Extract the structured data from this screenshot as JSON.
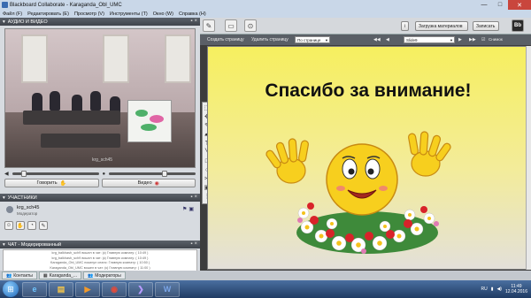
{
  "window": {
    "title": "Blackboard Collaborate - Karaganda_Obl_UMC",
    "minimize": "—",
    "maximize": "□",
    "close": "✕"
  },
  "menu": {
    "items": [
      "Файл (F)",
      "Редактировать (E)",
      "Просмотр (V)",
      "Инструменты (T)",
      "Окно (W)",
      "Справка (H)"
    ]
  },
  "audio_video": {
    "header": "АУДИО И ВИДЕО",
    "video_label": "krg_sch45",
    "talk_button": "Говорить",
    "video_button": "Видео"
  },
  "participants": {
    "header": "УЧАСТНИКИ",
    "items": [
      {
        "name": "krg_sch45",
        "role": "Модератор"
      }
    ]
  },
  "chat": {
    "header": "ЧАТ - Модерированный",
    "lines": [
      "krg_balkhash_sch9 вошел в чат: (к) Главную комнату: ( 10:49 )",
      "krg_balkhash_sch9 вошел в чат: (к) Главную комнату: ( 10:49 )",
      "Karaganda_Obl_UMC покинул сеанс: Главную комнату: ( 10:50 )",
      "Karaganda_Obl_UMC вошел в чат: (к) Главную комнату: ( 11:00 )"
    ]
  },
  "bottom_tabs": {
    "items": [
      "Контакты",
      "Karaganda_...",
      "Модераторы"
    ]
  },
  "toolbar": {
    "load_content": "Загрузка материалов",
    "record": "Записать",
    "save_page": "Создать страницу",
    "delete_page": "Удалить страницу",
    "page_select": "По странице",
    "slide_select": "Slide9",
    "sync": "Синхронизировать",
    "snap": "Снимок"
  },
  "slide": {
    "title": "Спасибо за внимание!"
  },
  "taskbar": {
    "language": "RU",
    "time": "11:49",
    "date": "12.04.2016"
  }
}
